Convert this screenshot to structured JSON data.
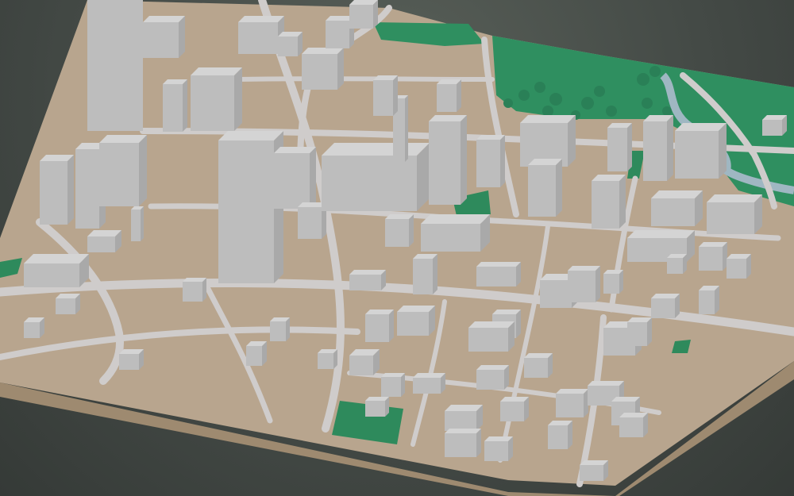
{
  "scene": {
    "kind": "3d-city-terrain-model",
    "colors": {
      "background": "#4a514c",
      "ground": "#b8a58e",
      "ground_side": "#9e8a70",
      "road": "#cfcccb",
      "building_top": "#d4d4d4",
      "building_left": "#bdbdbd",
      "building_right": "#a9a9a9",
      "park": "#2f8f60",
      "tree": "#2a8057",
      "river": "#9fb7c2"
    }
  }
}
